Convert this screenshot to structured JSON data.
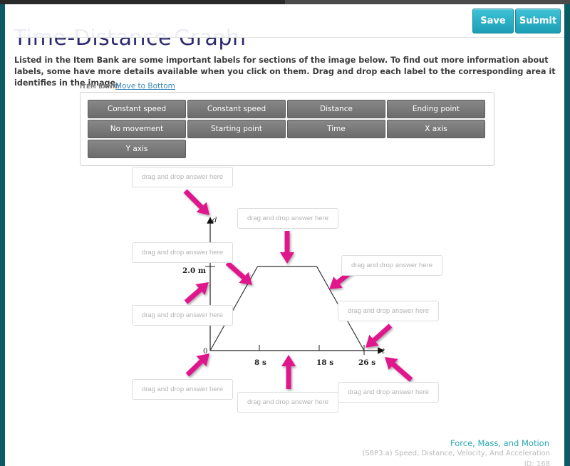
{
  "header": {
    "title": "Time-Distance Graph",
    "save_label": "Save",
    "submit_label": "Submit"
  },
  "instructions": "Listed in the Item Bank are some important labels for sections of the image below. To find out more information about labels, some have more details available when you click on them. Drag and drop each label to the corresponding area it identifies in the image.",
  "item_bank": {
    "label": "ITEM BANK:",
    "move_link": "Move to Bottom",
    "items": [
      {
        "label": "Constant speed"
      },
      {
        "label": "Constant speed"
      },
      {
        "label": "Distance"
      },
      {
        "label": "Ending point"
      },
      {
        "label": "No movement"
      },
      {
        "label": "Starting point"
      },
      {
        "label": "Time"
      },
      {
        "label": "X axis"
      },
      {
        "label": "Y axis"
      }
    ]
  },
  "drop_zones": [
    {
      "placeholder": "drag and drop answer here",
      "target": "y-axis-top-d"
    },
    {
      "placeholder": "drag and drop answer here",
      "target": "flat-segment"
    },
    {
      "placeholder": "drag and drop answer here",
      "target": "rising-segment"
    },
    {
      "placeholder": "drag and drop answer here",
      "target": "falling-segment"
    },
    {
      "placeholder": "drag and drop answer here",
      "target": "y-axis"
    },
    {
      "placeholder": "drag and drop answer here",
      "target": "ending-point"
    },
    {
      "placeholder": "drag and drop answer here",
      "target": "origin"
    },
    {
      "placeholder": "drag and drop answer here",
      "target": "x-axis"
    },
    {
      "placeholder": "drag and drop answer here",
      "target": "t-axis-end"
    }
  ],
  "graph": {
    "y_axis_var": "d",
    "x_axis_var": "t",
    "origin_label": "0",
    "y_tick_label": "2.0 m",
    "x_tick_labels": [
      "8 s",
      "18 s",
      "26 s"
    ],
    "segments": [
      {
        "t_start": 0,
        "t_end": 8,
        "d_start": 0,
        "d_end": 2.0
      },
      {
        "t_start": 8,
        "t_end": 18,
        "d_start": 2.0,
        "d_end": 2.0
      },
      {
        "t_start": 18,
        "t_end": 26,
        "d_start": 2.0,
        "d_end": 0
      }
    ],
    "arrow_color": "#e0148c"
  },
  "footer": {
    "topic": "Force, Mass, and Motion",
    "standard": "(S8P3.a) Speed, Distance, Velocity, And Acceleration",
    "id": "ID: 168"
  }
}
